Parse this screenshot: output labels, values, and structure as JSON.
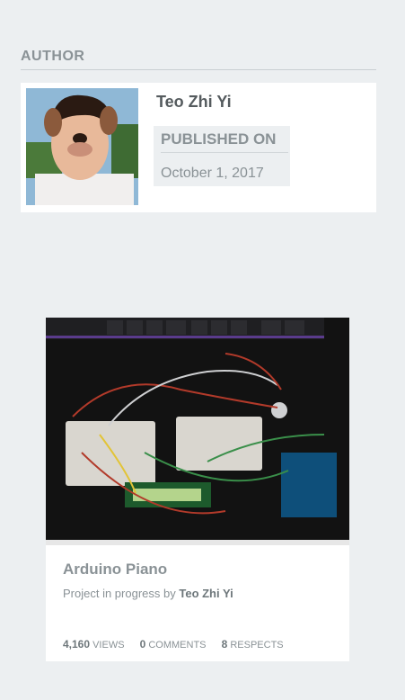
{
  "section": {
    "title": "AUTHOR"
  },
  "author": {
    "name": "Teo Zhi Yi",
    "published_label": "PUBLISHED ON",
    "published_date": "October 1, 2017"
  },
  "project": {
    "title": "Arduino Piano",
    "byline_prefix": "Project in progress by",
    "byline_author": "Teo Zhi Yi",
    "stats": {
      "views_count": "4,160",
      "views_label": "VIEWS",
      "comments_count": "0",
      "comments_label": "COMMENTS",
      "respects_count": "8",
      "respects_label": "RESPECTS"
    }
  }
}
